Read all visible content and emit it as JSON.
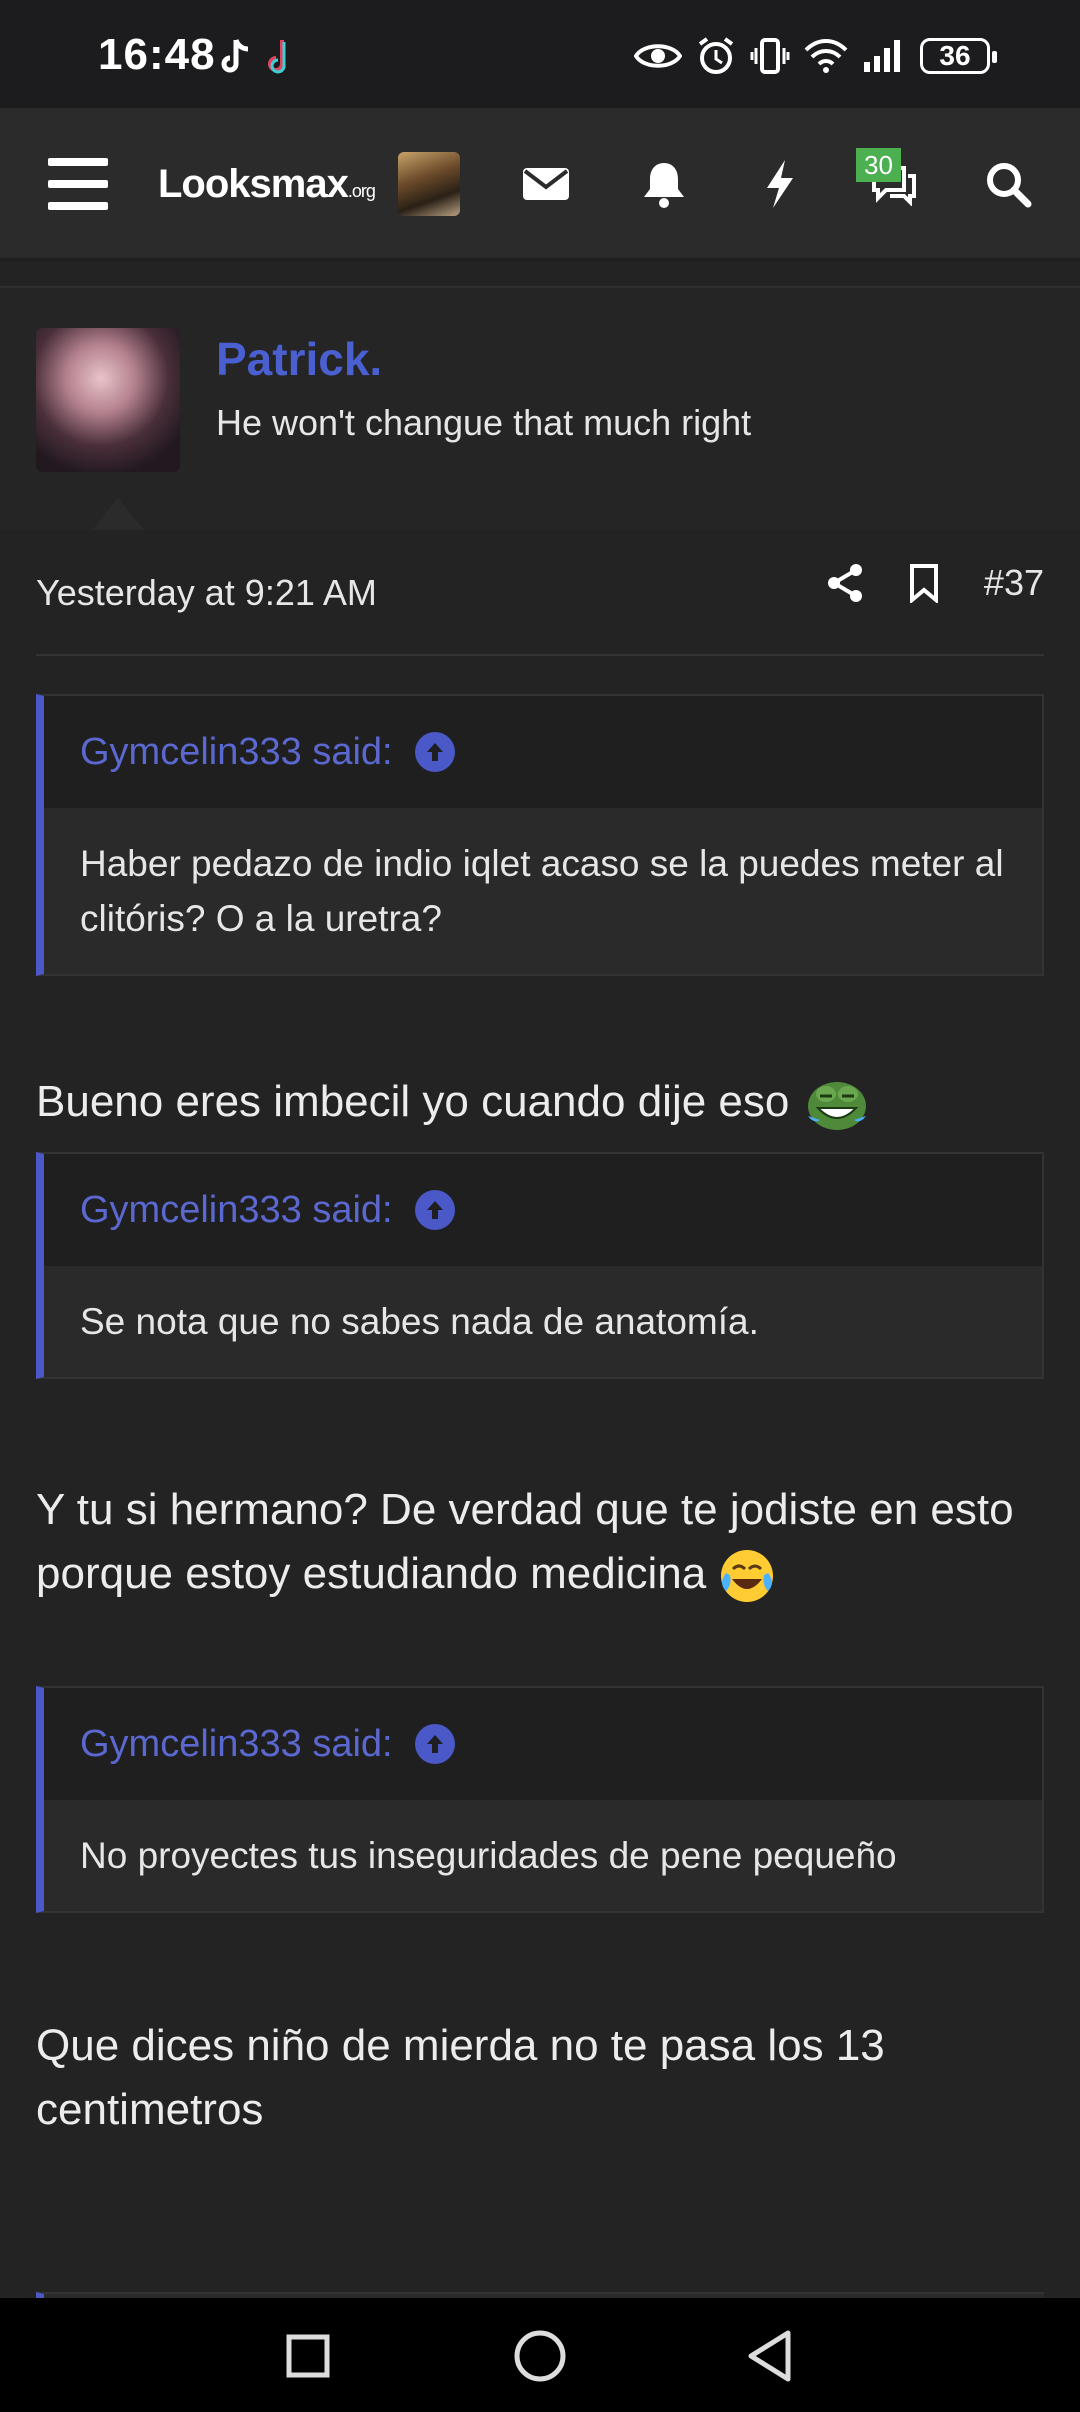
{
  "status_bar": {
    "time": "16:48",
    "battery": "36",
    "left_icons": [
      "tiktok-icon",
      "tiktok-icon"
    ],
    "right_icons": [
      "eye-icon",
      "alarm-icon",
      "vibrate-icon",
      "wifi-icon",
      "signal-icon",
      "battery-icon"
    ]
  },
  "header": {
    "logo_main": "Looksmax",
    "logo_suffix": ".org",
    "conversations_badge": "30",
    "icons": [
      "menu-icon",
      "mail-icon",
      "bell-icon",
      "bolt-icon",
      "chat-icon",
      "search-icon"
    ]
  },
  "profile": {
    "name": "Patrick.",
    "status": "He won't changue that much right"
  },
  "post": {
    "timestamp": "Yesterday at 9:21 AM",
    "post_number": "#37",
    "blocks": [
      {
        "quote_author": "Gymcelin333 said:",
        "quote_text": "Haber pedazo de indio iqlet acaso se la puedes meter al clitóris? O a la uretra?"
      },
      {
        "reply": "Bueno eres imbecil yo cuando dije eso"
      },
      {
        "quote_author": "Gymcelin333 said:",
        "quote_text": "Se nota que no sabes nada de anatomía."
      },
      {
        "reply": "Y tu si hermano? De verdad que te jodiste en esto porque estoy estudiando medicina"
      },
      {
        "quote_author": "Gymcelin333 said:",
        "quote_text": "No proyectes tus inseguridades de pene pequeño"
      },
      {
        "reply": "Que dices niño de mierda no te pasa los 13 centimetros"
      }
    ]
  },
  "colors": {
    "accent": "#4a58c8",
    "username": "#4a5fd0",
    "badge": "#4caf50",
    "background": "#232323"
  }
}
